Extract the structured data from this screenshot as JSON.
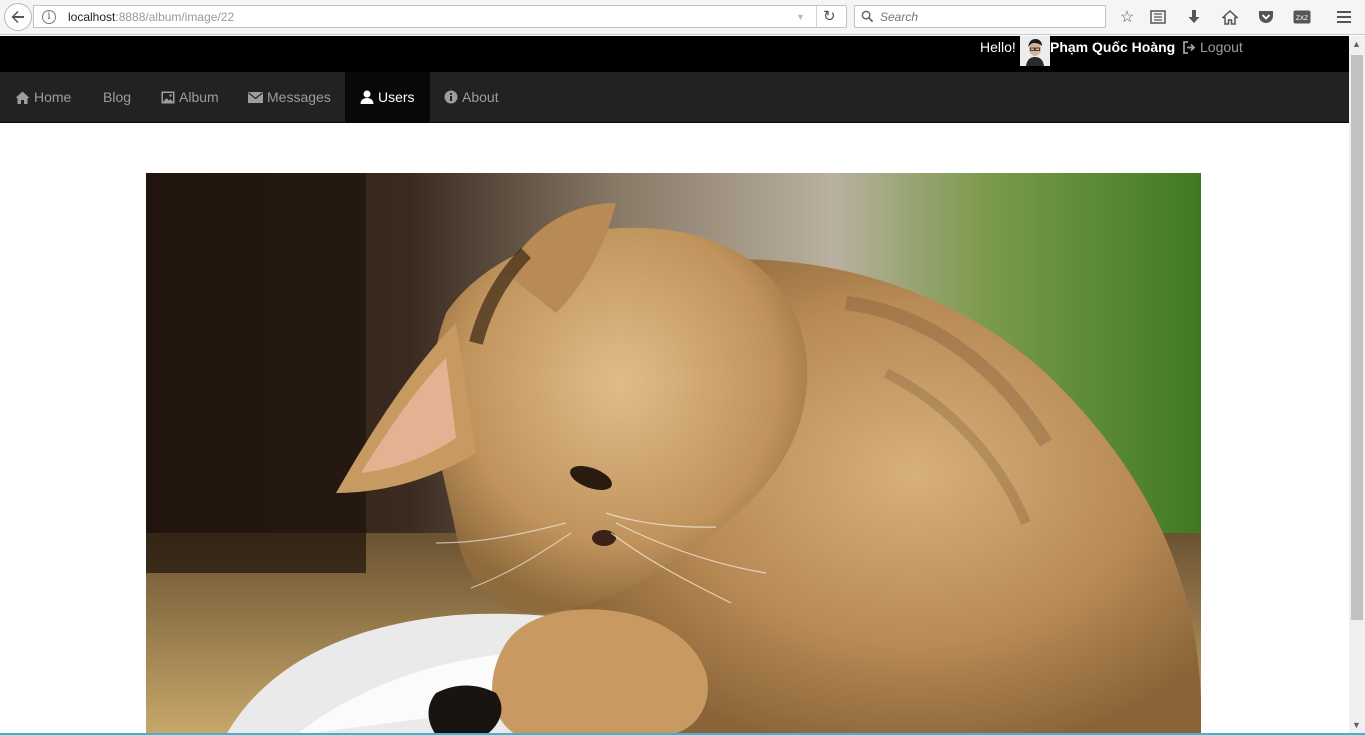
{
  "browser": {
    "url_host": "localhost",
    "url_path": ":8888/album/image/22",
    "search_placeholder": "Search"
  },
  "header": {
    "greeting": "Hello!",
    "username": "Phạm Quốc Hoàng",
    "logout_label": "Logout"
  },
  "nav": {
    "items": [
      {
        "label": "Home",
        "icon": "home-icon"
      },
      {
        "label": "Blog",
        "icon": ""
      },
      {
        "label": "Album",
        "icon": "picture-icon"
      },
      {
        "label": "Messages",
        "icon": "envelope-icon"
      },
      {
        "label": "Users",
        "icon": "user-icon",
        "active": true
      },
      {
        "label": "About",
        "icon": "info-icon"
      }
    ]
  },
  "colors": {
    "topbar": "#000000",
    "navbar": "#222222",
    "nav_active": "#080808",
    "nav_text": "#9d9d9d"
  }
}
